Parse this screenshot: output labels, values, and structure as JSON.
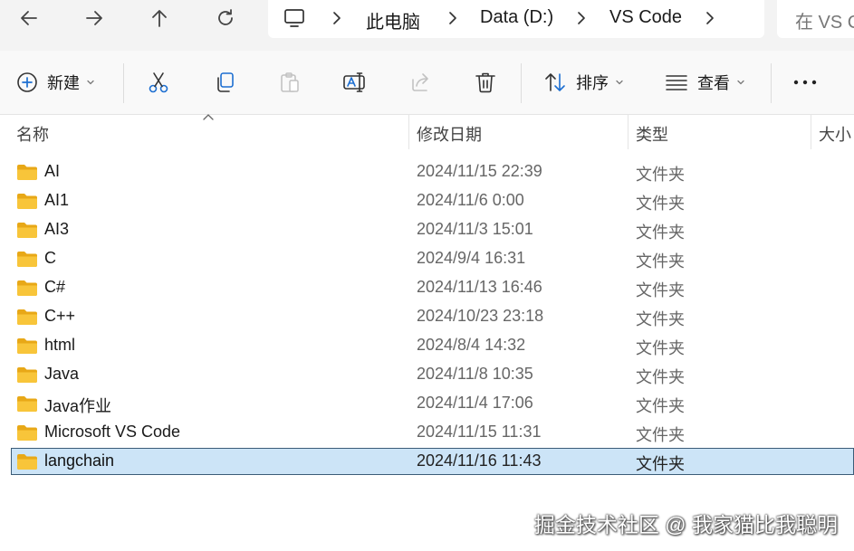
{
  "address_bar": {
    "breadcrumb": [
      "此电脑",
      "Data (D:)",
      "VS Code"
    ],
    "search_placeholder": "在 VS C"
  },
  "command_bar": {
    "new_label": "新建",
    "sort_label": "排序",
    "view_label": "查看"
  },
  "columns": {
    "name": "名称",
    "modified": "修改日期",
    "type": "类型",
    "size": "大小"
  },
  "files": [
    {
      "name": "AI",
      "modified": "2024/11/15 22:39",
      "type": "文件夹",
      "selected": false
    },
    {
      "name": "AI1",
      "modified": "2024/11/6 0:00",
      "type": "文件夹",
      "selected": false
    },
    {
      "name": "AI3",
      "modified": "2024/11/3 15:01",
      "type": "文件夹",
      "selected": false
    },
    {
      "name": "C",
      "modified": "2024/9/4 16:31",
      "type": "文件夹",
      "selected": false
    },
    {
      "name": "C#",
      "modified": "2024/11/13 16:46",
      "type": "文件夹",
      "selected": false
    },
    {
      "name": "C++",
      "modified": "2024/10/23 23:18",
      "type": "文件夹",
      "selected": false
    },
    {
      "name": "html",
      "modified": "2024/8/4 14:32",
      "type": "文件夹",
      "selected": false
    },
    {
      "name": "Java",
      "modified": "2024/11/8 10:35",
      "type": "文件夹",
      "selected": false
    },
    {
      "name": "Java作业",
      "modified": "2024/11/4 17:06",
      "type": "文件夹",
      "selected": false
    },
    {
      "name": "Microsoft VS Code",
      "modified": "2024/11/15 11:31",
      "type": "文件夹",
      "selected": false
    },
    {
      "name": "langchain",
      "modified": "2024/11/16 11:43",
      "type": "文件夹",
      "selected": true
    }
  ],
  "watermark": "掘金技术社区 @ 我家猫比我聪明",
  "colors": {
    "selection_bg": "#cce4f7",
    "selection_border": "#3b5c78",
    "folder_yellow": "#f8c53a",
    "folder_dark": "#e8a817"
  }
}
